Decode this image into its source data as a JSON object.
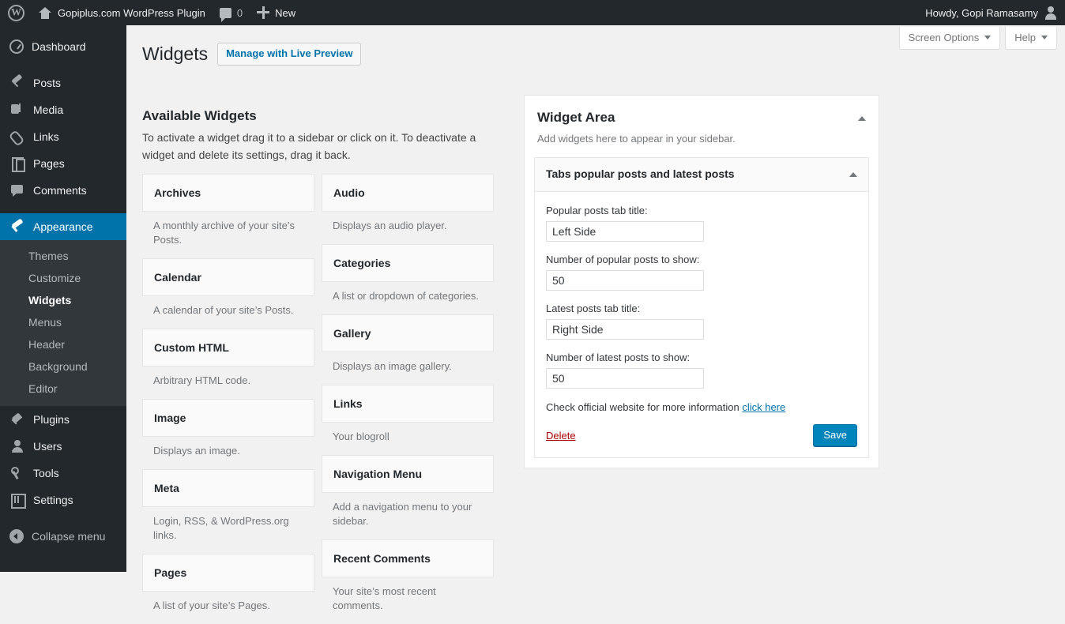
{
  "adminbar": {
    "site_name": "Gopiplus.com WordPress Plugin",
    "comment_count": "0",
    "new_label": "New",
    "howdy": "Howdy, Gopi Ramasamy"
  },
  "sidebar": {
    "items": [
      {
        "label": "Dashboard",
        "icon": "dashboard-icon",
        "current": false
      },
      {
        "label": "Posts",
        "icon": "pin-icon",
        "current": false
      },
      {
        "label": "Media",
        "icon": "media-icon",
        "current": false
      },
      {
        "label": "Links",
        "icon": "link-icon",
        "current": false
      },
      {
        "label": "Pages",
        "icon": "page-icon",
        "current": false
      },
      {
        "label": "Comments",
        "icon": "comment-icon",
        "current": false
      },
      {
        "label": "Appearance",
        "icon": "appearance-icon",
        "current": true
      },
      {
        "label": "Plugins",
        "icon": "plugin-icon",
        "current": false
      },
      {
        "label": "Users",
        "icon": "user-icon",
        "current": false
      },
      {
        "label": "Tools",
        "icon": "tool-icon",
        "current": false
      },
      {
        "label": "Settings",
        "icon": "settings-icon",
        "current": false
      },
      {
        "label": "Collapse menu",
        "icon": "collapse-icon",
        "current": false
      }
    ],
    "submenu": [
      {
        "label": "Themes",
        "current": false
      },
      {
        "label": "Customize",
        "current": false
      },
      {
        "label": "Widgets",
        "current": true
      },
      {
        "label": "Menus",
        "current": false
      },
      {
        "label": "Header",
        "current": false
      },
      {
        "label": "Background",
        "current": false
      },
      {
        "label": "Editor",
        "current": false
      }
    ]
  },
  "screen_meta": {
    "screen_options": "Screen Options",
    "help": "Help"
  },
  "page": {
    "title": "Widgets",
    "live_preview_button": "Manage with Live Preview",
    "section_title": "Available Widgets",
    "section_desc": "To activate a widget drag it to a sidebar or click on it. To deactivate a widget and delete its settings, drag it back."
  },
  "available_widgets": [
    {
      "name": "Archives",
      "desc": "A monthly archive of your site’s Posts."
    },
    {
      "name": "Audio",
      "desc": "Displays an audio player."
    },
    {
      "name": "Calendar",
      "desc": "A calendar of your site’s Posts."
    },
    {
      "name": "Categories",
      "desc": "A list or dropdown of categories."
    },
    {
      "name": "Custom HTML",
      "desc": "Arbitrary HTML code."
    },
    {
      "name": "Gallery",
      "desc": "Displays an image gallery."
    },
    {
      "name": "Image",
      "desc": "Displays an image."
    },
    {
      "name": "Links",
      "desc": "Your blogroll"
    },
    {
      "name": "Meta",
      "desc": "Login, RSS, & WordPress.org links."
    },
    {
      "name": "Navigation Menu",
      "desc": "Add a navigation menu to your sidebar."
    },
    {
      "name": "Pages",
      "desc": "A list of your site’s Pages."
    },
    {
      "name": "Recent Comments",
      "desc": "Your site’s most recent comments."
    }
  ],
  "widget_area": {
    "name": "Widget Area",
    "desc": "Add widgets here to appear in your sidebar.",
    "widget": {
      "title": "Tabs popular posts and latest posts",
      "fields": [
        {
          "label": "Popular posts tab title:",
          "value": "Left Side"
        },
        {
          "label": "Number of popular posts to show:",
          "value": "50"
        },
        {
          "label": "Latest posts tab title:",
          "value": "Right Side"
        },
        {
          "label": "Number of latest posts to show:",
          "value": "50"
        }
      ],
      "info_text": "Check official website for more information",
      "info_link": "click here",
      "delete_label": "Delete",
      "save_label": "Save"
    }
  },
  "colors": {
    "admin_bar_bg": "#23282d",
    "sidebar_bg": "#23282d",
    "submenu_bg": "#32373c",
    "current_menu_bg": "#0073aa",
    "accent_link": "#0073aa",
    "save_button": "#0085ba",
    "delete_link": "#a00",
    "content_bg": "#f1f1f1"
  }
}
